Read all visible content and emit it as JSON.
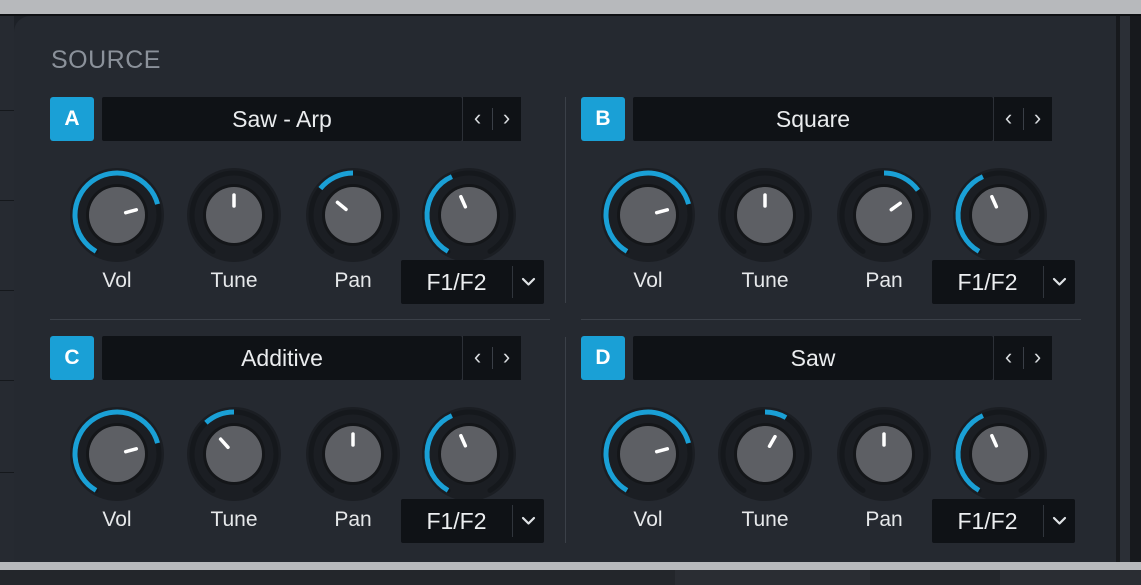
{
  "section": {
    "title": "SOURCE"
  },
  "colors": {
    "accent": "#1aa0d6",
    "panel": "#252930",
    "field": "#0f1216",
    "knob_track": "#15181c",
    "knob_body": "#5d5f64",
    "indicator": "#ffffff"
  },
  "icons": {
    "prev": "chevron-left-icon",
    "next": "chevron-right-icon",
    "dropdown": "chevron-down-icon"
  },
  "oscillators": [
    {
      "id": "A",
      "name": "Saw - Arp",
      "prev_label": "‹",
      "next_label": "›",
      "knobs": [
        {
          "label": "Vol",
          "value": 0.75,
          "bipolar": false
        },
        {
          "label": "Tune",
          "value": 0.5,
          "bipolar": true
        },
        {
          "label": "Pan",
          "value": 0.33,
          "bipolar": true
        },
        {
          "label": "F1/F2",
          "value": 0.42,
          "bipolar": false
        }
      ],
      "routing": "F1/F2"
    },
    {
      "id": "B",
      "name": "Square",
      "prev_label": "‹",
      "next_label": "›",
      "knobs": [
        {
          "label": "Vol",
          "value": 0.75,
          "bipolar": false
        },
        {
          "label": "Tune",
          "value": 0.5,
          "bipolar": true
        },
        {
          "label": "Pan",
          "value": 0.68,
          "bipolar": true
        },
        {
          "label": "F1/F2",
          "value": 0.42,
          "bipolar": false
        }
      ],
      "routing": "F1/F2"
    },
    {
      "id": "C",
      "name": "Additive",
      "prev_label": "‹",
      "next_label": "›",
      "knobs": [
        {
          "label": "Vol",
          "value": 0.75,
          "bipolar": false
        },
        {
          "label": "Tune",
          "value": 0.36,
          "bipolar": true
        },
        {
          "label": "Pan",
          "value": 0.5,
          "bipolar": true
        },
        {
          "label": "F1/F2",
          "value": 0.42,
          "bipolar": false
        }
      ],
      "routing": "F1/F2"
    },
    {
      "id": "D",
      "name": "Saw",
      "prev_label": "‹",
      "next_label": "›",
      "knobs": [
        {
          "label": "Vol",
          "value": 0.75,
          "bipolar": false
        },
        {
          "label": "Tune",
          "value": 0.6,
          "bipolar": true
        },
        {
          "label": "Pan",
          "value": 0.5,
          "bipolar": true
        },
        {
          "label": "F1/F2",
          "value": 0.42,
          "bipolar": false
        }
      ],
      "routing": "F1/F2"
    }
  ]
}
